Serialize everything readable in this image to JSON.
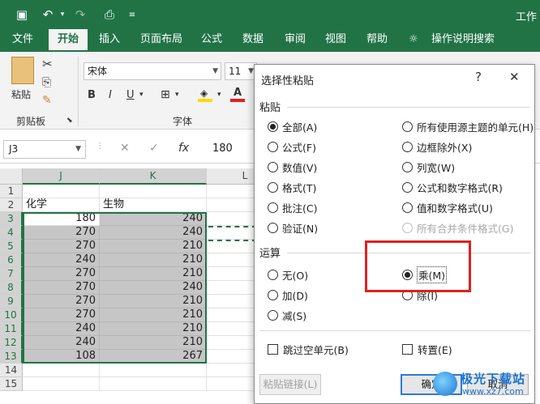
{
  "window": {
    "title": "工作"
  },
  "ribbon_tabs": [
    "文件",
    "开始",
    "插入",
    "页面布局",
    "公式",
    "数据",
    "审阅",
    "视图",
    "帮助",
    "操作说明搜索"
  ],
  "active_tab": "开始",
  "clipboard": {
    "paste_label": "粘贴",
    "group_label": "剪贴板"
  },
  "font": {
    "name": "宋体",
    "size": "11",
    "group_label": "字体",
    "bold": "B",
    "italic": "I",
    "underline": "U"
  },
  "formula_bar": {
    "name_box": "J3",
    "cancel": "✕",
    "enter": "✓",
    "fx": "fx",
    "value": "180"
  },
  "grid": {
    "columns": [
      "J",
      "K",
      "L"
    ],
    "rows": [
      "1",
      "2",
      "3",
      "4",
      "5",
      "6",
      "7",
      "8",
      "9",
      "10",
      "11",
      "12",
      "13",
      "14",
      "15"
    ],
    "header_row": [
      "化学",
      "生物"
    ],
    "values": [
      [
        "180",
        "240"
      ],
      [
        "270",
        "240"
      ],
      [
        "270",
        "210"
      ],
      [
        "240",
        "210"
      ],
      [
        "270",
        "210"
      ],
      [
        "270",
        "240"
      ],
      [
        "270",
        "210"
      ],
      [
        "270",
        "210"
      ],
      [
        "240",
        "210"
      ],
      [
        "240",
        "210"
      ],
      [
        "108",
        "267"
      ]
    ]
  },
  "dialog": {
    "title": "选择性粘贴",
    "help": "?",
    "close": "✕",
    "paste_section": "粘贴",
    "paste_left": [
      "全部(A)",
      "公式(F)",
      "数值(V)",
      "格式(T)",
      "批注(C)",
      "验证(N)"
    ],
    "paste_right": [
      "所有使用源主题的单元(H)",
      "边框除外(X)",
      "列宽(W)",
      "公式和数字格式(R)",
      "值和数字格式(U)",
      "所有合并条件格式(G)"
    ],
    "operation_section": "运算",
    "operation_left": [
      "无(O)",
      "加(D)",
      "减(S)"
    ],
    "operation_right": [
      "乘(M)",
      "除(I)"
    ],
    "skip_blanks": "跳过空单元(B)",
    "transpose": "转置(E)",
    "paste_link": "粘贴链接(L)",
    "ok": "确定",
    "cancel": "取消"
  },
  "watermark": {
    "text": "极光下载站",
    "url": "www.xz7.com"
  },
  "colors": {
    "excel_green": "#217346",
    "highlight_red": "#e02020",
    "selection_gray": "#c6c6c6"
  }
}
